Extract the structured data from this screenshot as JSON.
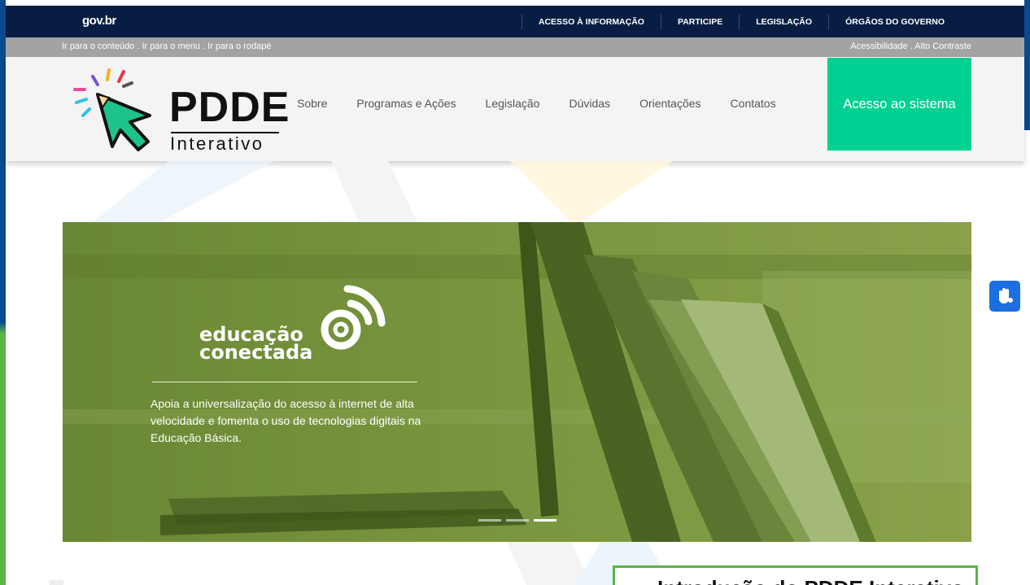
{
  "govbar": {
    "logo": "gov.br",
    "links": [
      "ACESSO À INFORMAÇÃO",
      "PARTICIPE",
      "LEGISLAÇÃO",
      "ÓRGÃOS DO GOVERNO"
    ]
  },
  "accessibility": {
    "left": "Ir para o conteúdo . Ir para o menu . Ir para o rodapé",
    "right": "Acessibilidade . Alto Contraste"
  },
  "brand": {
    "title": "PDDE",
    "subtitle": "Interativo"
  },
  "nav": {
    "items": [
      "Sobre",
      "Programas e Ações",
      "Legislação",
      "Dúvidas",
      "Orientações",
      "Contatos"
    ],
    "cta": "Acesso ao sistema"
  },
  "hero": {
    "brand_line1": "educação",
    "brand_line2": "conectada",
    "description": "Apoia a universalização do acesso à internet de alta velocidade e fomenta o uso de tecnologias digitais na Educação Básica.",
    "slides_total": 3,
    "active_slide": 3
  },
  "card": {
    "title": "Introdução do PDDE Interativo"
  },
  "colors": {
    "govbar": "#071d41",
    "cta": "#00d193",
    "hero_tint": "#6f8a3a",
    "card_border": "#5bb548",
    "libras": "#1b6fe0"
  },
  "icons": {
    "libras": "sign-language-hand-icon",
    "brand": "pencil-cursor-icon"
  }
}
